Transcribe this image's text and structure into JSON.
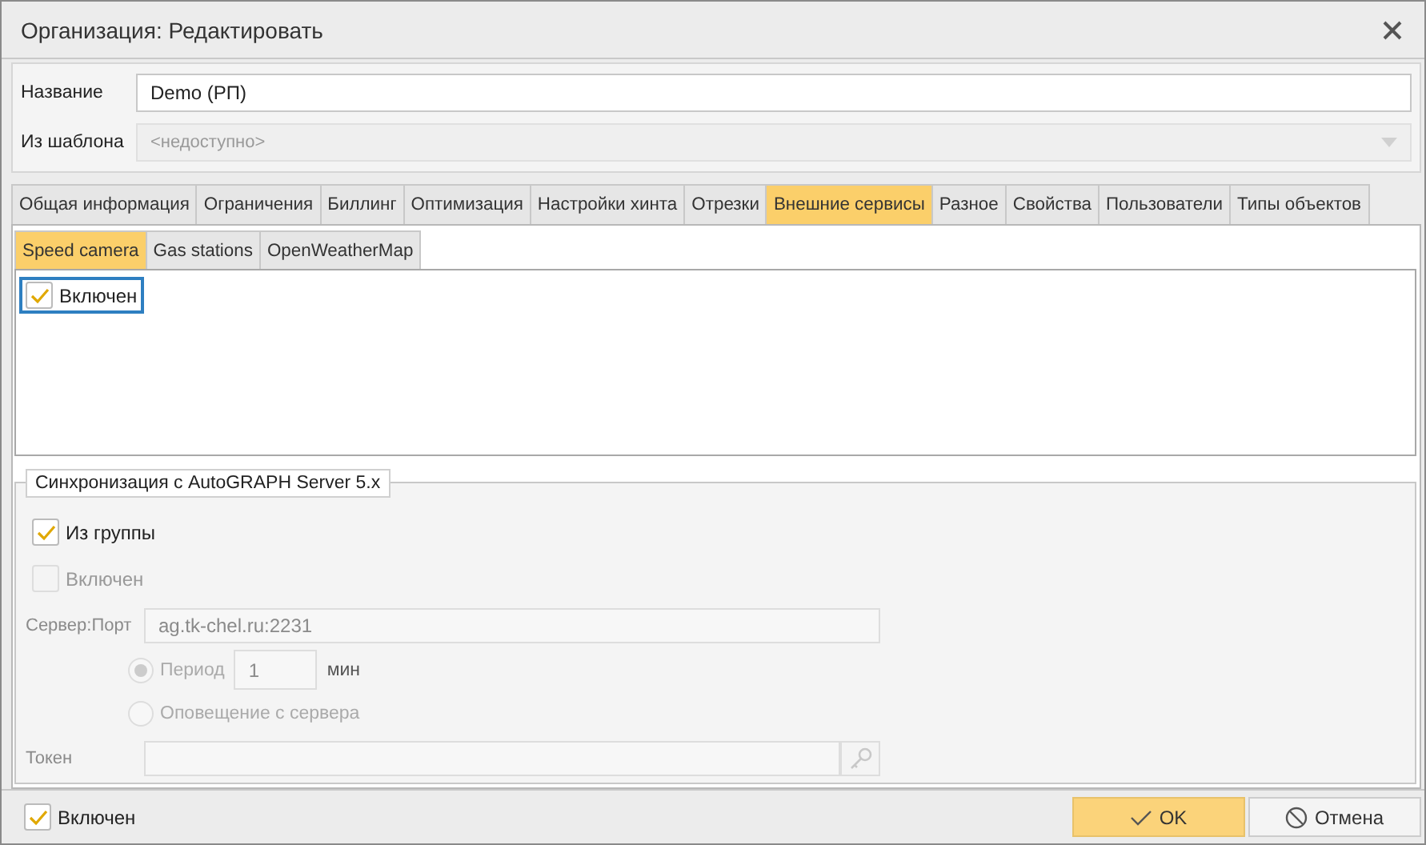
{
  "window": {
    "title": "Организация: Редактировать"
  },
  "form": {
    "name": {
      "label": "Название",
      "value": "Demo (РП)"
    },
    "template": {
      "label": "Из шаблона",
      "placeholder": "<недоступно>",
      "disabled": true
    }
  },
  "tabs": [
    {
      "label": "Общая информация",
      "selected": false
    },
    {
      "label": "Ограничения",
      "selected": false
    },
    {
      "label": "Биллинг",
      "selected": false
    },
    {
      "label": "Оптимизация",
      "selected": false
    },
    {
      "label": "Настройки хинта",
      "selected": false
    },
    {
      "label": "Отрезки",
      "selected": false
    },
    {
      "label": "Внешние сервисы",
      "selected": true
    },
    {
      "label": "Разное",
      "selected": false
    },
    {
      "label": "Свойства",
      "selected": false
    },
    {
      "label": "Пользователи",
      "selected": false
    },
    {
      "label": "Типы объектов",
      "selected": false
    }
  ],
  "subtabs": [
    {
      "label": "Speed camera",
      "selected": true
    },
    {
      "label": "Gas stations",
      "selected": false
    },
    {
      "label": "OpenWeatherMap",
      "selected": false
    }
  ],
  "service": {
    "label": "Включен",
    "checked": true,
    "focused": true
  },
  "sync": {
    "title": "Синхронизация с AutoGRAPH Server 5.x",
    "from_group": {
      "label": "Из группы",
      "checked": true,
      "disabled": false
    },
    "enabled": {
      "label": "Включен",
      "checked": false,
      "disabled": true
    },
    "server": {
      "label": "Сервер:Порт",
      "value": "ag.tk-chel.ru:2231",
      "disabled": true
    },
    "modes": [
      {
        "label": "Период",
        "value": "1",
        "unit": "мин",
        "selected": true,
        "disabled": true
      },
      {
        "label": "Оповещение с сервера",
        "selected": false,
        "disabled": true
      }
    ],
    "token": {
      "label": "Токен",
      "disabled": true
    }
  },
  "footer": {
    "enabled": {
      "label": "Включен",
      "checked": true
    },
    "buttons": [
      {
        "label": "OK",
        "kind": "ok"
      },
      {
        "label": "Отмена",
        "kind": "cancel"
      }
    ]
  }
}
